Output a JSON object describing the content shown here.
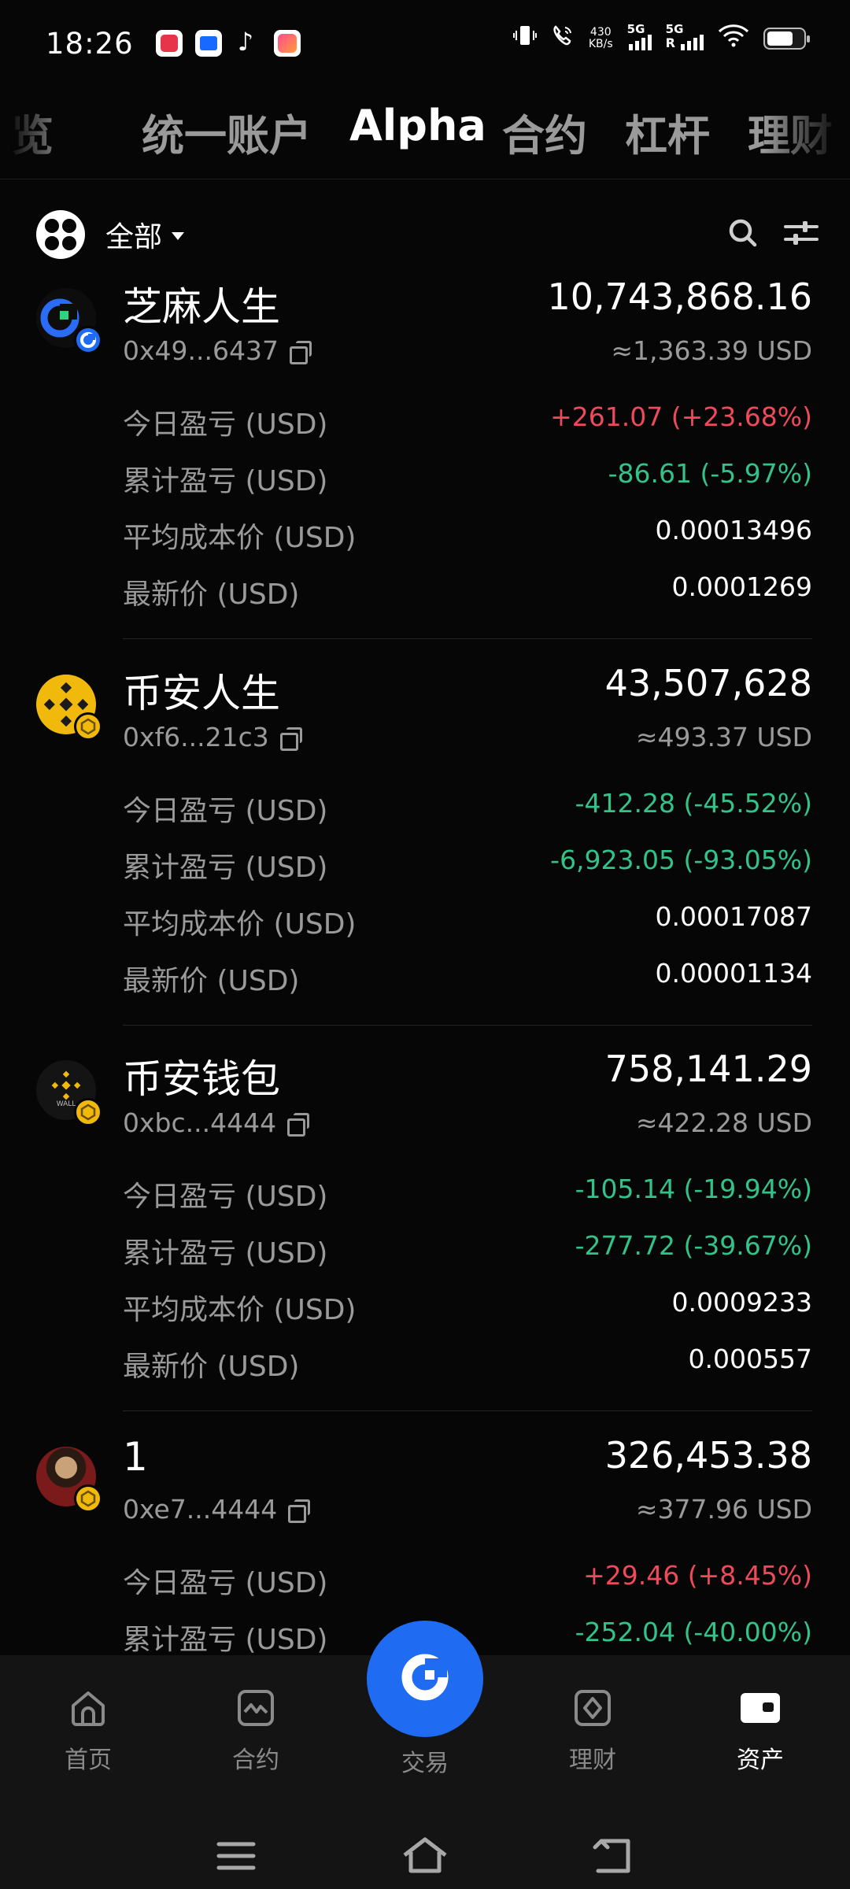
{
  "status_bar": {
    "time": "18:26",
    "net_speed_value": "430",
    "net_speed_unit": "KB/s",
    "signal1_label": "5G",
    "signal2_label": "5G",
    "roaming_label": "R"
  },
  "top_tabs": [
    {
      "label": "总览",
      "active": false
    },
    {
      "label": "统一账户",
      "active": false
    },
    {
      "label": "Alpha",
      "active": true
    },
    {
      "label": "合约",
      "active": false
    },
    {
      "label": "杠杆",
      "active": false
    },
    {
      "label": "理财",
      "active": false
    }
  ],
  "filter": {
    "label": "全部"
  },
  "assets": [
    {
      "name": "芝麻人生",
      "address": "0x49...6437",
      "amount": "10,743,868.16",
      "usd_value": "≈1,363.39 USD",
      "icon": "gate-logo-icon",
      "metrics": [
        {
          "label": "今日盈亏 (USD)",
          "value": "+261.07 (+23.68%)",
          "trend": "up"
        },
        {
          "label": "累计盈亏 (USD)",
          "value": "-86.61 (-5.97%)",
          "trend": "down"
        },
        {
          "label": "平均成本价 (USD)",
          "value": "0.00013496",
          "trend": "neutral"
        },
        {
          "label": "最新价 (USD)",
          "value": "0.0001269",
          "trend": "neutral"
        }
      ]
    },
    {
      "name": "币安人生",
      "address": "0xf6...21c3",
      "amount": "43,507,628",
      "usd_value": "≈493.37 USD",
      "icon": "binance-coin-icon",
      "metrics": [
        {
          "label": "今日盈亏 (USD)",
          "value": "-412.28 (-45.52%)",
          "trend": "down"
        },
        {
          "label": "累计盈亏 (USD)",
          "value": "-6,923.05 (-93.05%)",
          "trend": "down"
        },
        {
          "label": "平均成本价 (USD)",
          "value": "0.00017087",
          "trend": "neutral"
        },
        {
          "label": "最新价 (USD)",
          "value": "0.00001134",
          "trend": "neutral"
        }
      ]
    },
    {
      "name": "币安钱包",
      "address": "0xbc...4444",
      "amount": "758,141.29",
      "usd_value": "≈422.28 USD",
      "icon": "binance-wallet-icon",
      "icon_text": "WALL",
      "metrics": [
        {
          "label": "今日盈亏 (USD)",
          "value": "-105.14 (-19.94%)",
          "trend": "down"
        },
        {
          "label": "累计盈亏 (USD)",
          "value": "-277.72 (-39.67%)",
          "trend": "down"
        },
        {
          "label": "平均成本价 (USD)",
          "value": "0.0009233",
          "trend": "neutral"
        },
        {
          "label": "最新价 (USD)",
          "value": "0.000557",
          "trend": "neutral"
        }
      ]
    },
    {
      "name": "1",
      "address": "0xe7...4444",
      "amount": "326,453.38",
      "usd_value": "≈377.96 USD",
      "icon": "portrait-token-icon",
      "metrics": [
        {
          "label": "今日盈亏 (USD)",
          "value": "+29.46 (+8.45%)",
          "trend": "up"
        },
        {
          "label": "累计盈亏 (USD)",
          "value": "-252.04 (-40.00%)",
          "trend": "down"
        }
      ]
    }
  ],
  "bottom_nav": [
    {
      "label": "首页",
      "icon": "home-icon",
      "active": false
    },
    {
      "label": "合约",
      "icon": "chart-icon",
      "active": false
    },
    {
      "label": "交易",
      "icon": "trade-icon",
      "active": false
    },
    {
      "label": "理财",
      "icon": "finance-icon",
      "active": false
    },
    {
      "label": "资产",
      "icon": "wallet-icon",
      "active": true
    }
  ],
  "colors": {
    "background": "#060606",
    "positive": "#ee4a5a",
    "negative": "#33c28a",
    "accent": "#1f6cf3",
    "muted_text": "#9a9a9a"
  }
}
